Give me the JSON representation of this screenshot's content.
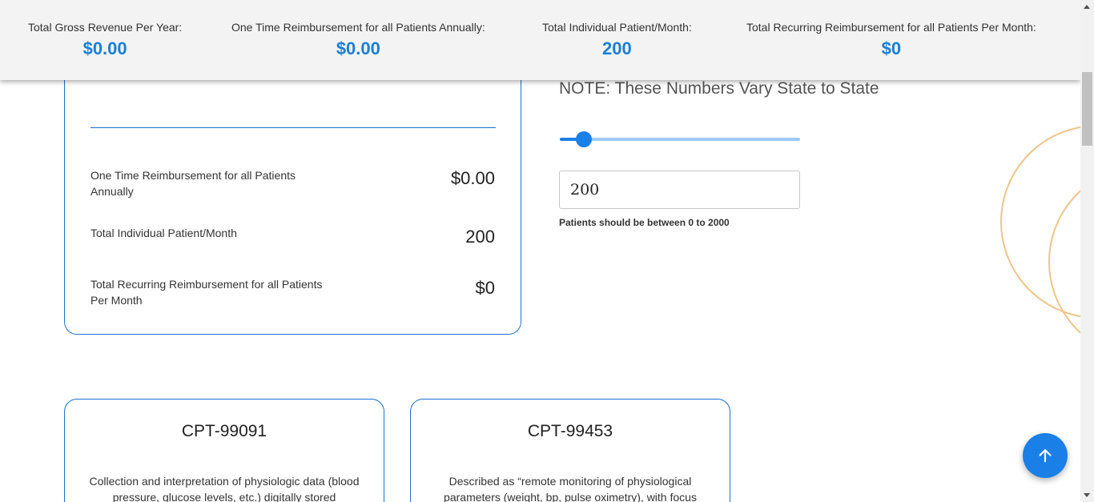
{
  "summary": {
    "gross_label": "Total Gross Revenue Per Year:",
    "gross_value": "$0.00",
    "onetime_label": "One Time Reimbursement for all Patients Annually:",
    "onetime_value": "$0.00",
    "patients_label": "Total Individual Patient/Month:",
    "patients_value": "200",
    "recurring_label": "Total Recurring Reimbursement for all Patients Per Month:",
    "recurring_value": "$0"
  },
  "calc_card": {
    "rows": [
      {
        "label": "One Time Reimbursement for all Patients Annually",
        "value": "$0.00"
      },
      {
        "label": "Total Individual Patient/Month",
        "value": "200"
      },
      {
        "label": "Total Recurring Reimbursement for all Patients Per Month",
        "value": "$0"
      }
    ]
  },
  "controls": {
    "note": "NOTE: These Numbers Vary State to State",
    "slider_fraction": 0.1,
    "patients_input_value": "200",
    "hint": "Patients should be between 0 to 2000"
  },
  "cpt_cards": [
    {
      "title": "CPT-99091",
      "description": "Collection and interpretation of physiologic data (blood pressure, glucose levels, etc.) digitally stored"
    },
    {
      "title": "CPT-99453",
      "description": "Described as “remote monitoring of physiological parameters (weight, bp, pulse oximetry), with focus"
    }
  ],
  "icons": {
    "scroll_top": "arrow-up-icon"
  },
  "colors": {
    "accent": "#1a7fe6",
    "value_blue": "#1a7fd6",
    "card_border": "#1e6fd1",
    "deco_circle": "#eec48a"
  }
}
